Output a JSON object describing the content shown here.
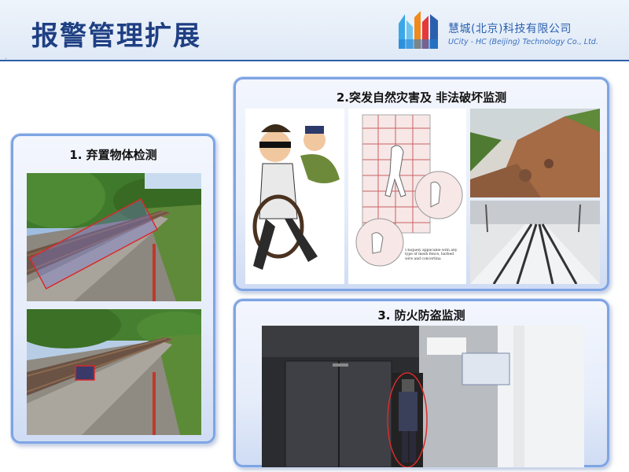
{
  "header": {
    "title": "报警管理扩展",
    "dot": ".",
    "company_cn": "慧城(北京)科技有限公司",
    "company_en": "UCity - HC (Beijing) Technology Co., Ltd."
  },
  "panels": [
    {
      "title": "1. 弃置物体检测"
    },
    {
      "title": "2.突发自然灾害及 非法破坏监测"
    },
    {
      "title": "3. 防火防盗监测"
    }
  ],
  "fence_caption": "Uniquely applicable with any type of mesh fence, barbed wire and concertina"
}
